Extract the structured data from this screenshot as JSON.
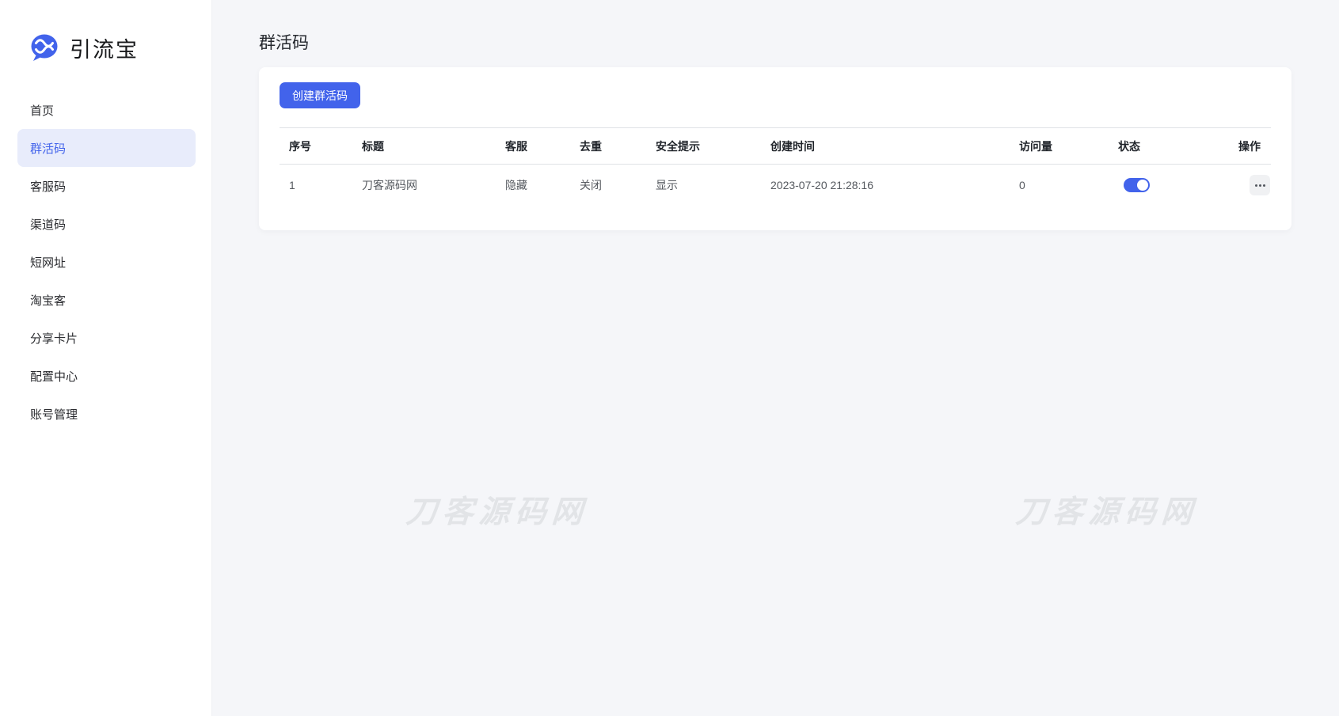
{
  "brand": {
    "name": "引流宝",
    "logo_icon": "chat-bubble-dna-icon"
  },
  "sidebar": {
    "items": [
      {
        "label": "首页",
        "active": false
      },
      {
        "label": "群活码",
        "active": true
      },
      {
        "label": "客服码",
        "active": false
      },
      {
        "label": "渠道码",
        "active": false
      },
      {
        "label": "短网址",
        "active": false
      },
      {
        "label": "淘宝客",
        "active": false
      },
      {
        "label": "分享卡片",
        "active": false
      },
      {
        "label": "配置中心",
        "active": false
      },
      {
        "label": "账号管理",
        "active": false
      }
    ]
  },
  "page": {
    "title": "群活码"
  },
  "toolbar": {
    "create_button": "创建群活码"
  },
  "table": {
    "columns": [
      "序号",
      "标题",
      "客服",
      "去重",
      "安全提示",
      "创建时间",
      "访问量",
      "状态",
      "操作"
    ],
    "rows": [
      {
        "index": "1",
        "title": "刀客源码网",
        "service": "隐藏",
        "dedupe": "关闭",
        "safety_tip": "显示",
        "created_at": "2023-07-20 21:28:16",
        "visits": "0",
        "status_on": true
      }
    ]
  },
  "watermark": {
    "text": "刀客源码网"
  },
  "colors": {
    "primary": "#4263eb",
    "primary_light_bg": "#e8ecfb",
    "page_bg": "#f5f6f9",
    "card_bg": "#ffffff",
    "watermark": "#e2e4e7",
    "header_text": "#1f2329",
    "body_text": "#55595f"
  }
}
